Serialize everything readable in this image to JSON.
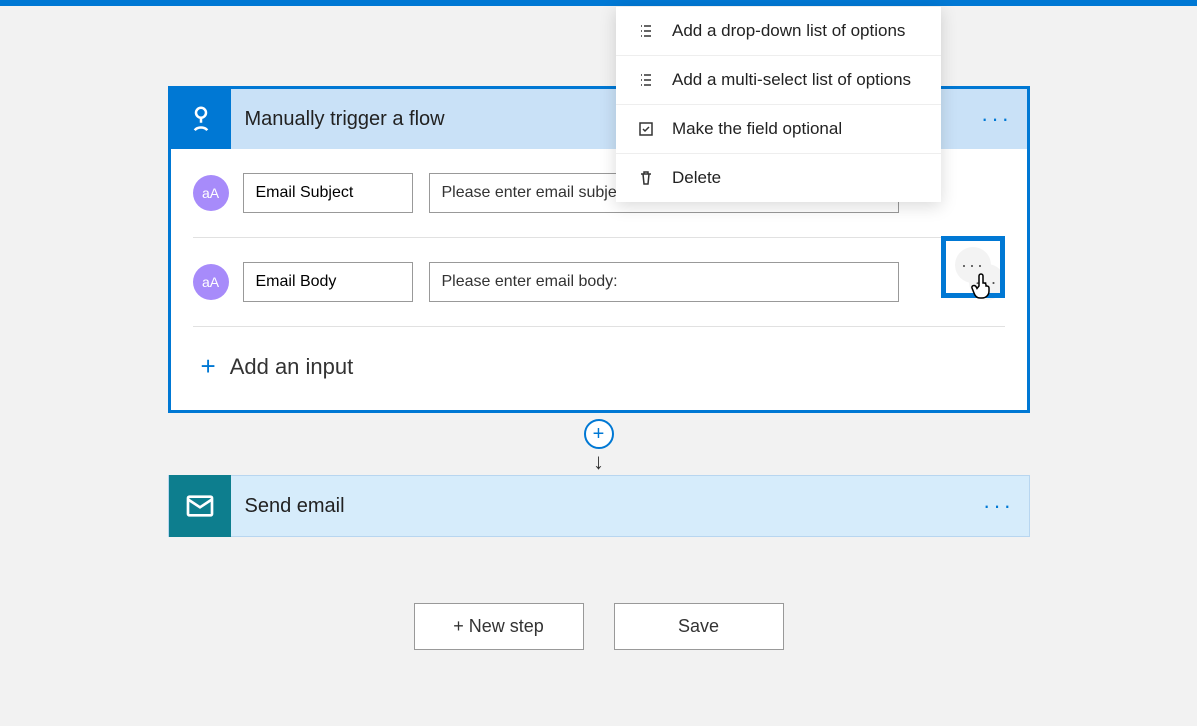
{
  "trigger": {
    "title": "Manually trigger a flow",
    "inputs": [
      {
        "name": "Email Subject",
        "placeholder": "Please enter email subject:",
        "icon": "aA"
      },
      {
        "name": "Email Body",
        "placeholder": "Please enter email body:",
        "icon": "aA"
      }
    ],
    "add_input_label": "Add an input"
  },
  "action": {
    "title": "Send email"
  },
  "footer": {
    "new_step": "+ New step",
    "save": "Save"
  },
  "dropdown": {
    "items": [
      {
        "label": "Add a drop-down list of options",
        "icon": "list"
      },
      {
        "label": "Add a multi-select list of options",
        "icon": "list"
      },
      {
        "label": "Make the field optional",
        "icon": "checkbox"
      },
      {
        "label": "Delete",
        "icon": "trash"
      }
    ]
  },
  "more_glyph": "···",
  "plus_glyph": "+",
  "cursor_glyph": "👆"
}
